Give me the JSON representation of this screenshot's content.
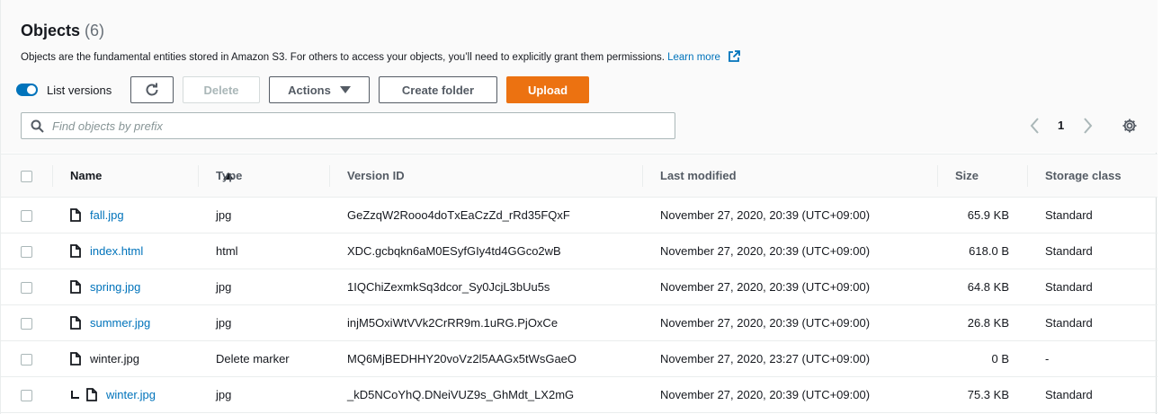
{
  "header": {
    "title": "Objects",
    "count": "(6)",
    "description": "Objects are the fundamental entities stored in Amazon S3. For others to access your objects, you’ll need to explicitly grant them permissions.",
    "learn_more": "Learn more"
  },
  "toolbar": {
    "list_versions_label": "List versions",
    "list_versions_enabled": true,
    "delete_label": "Delete",
    "actions_label": "Actions",
    "create_folder_label": "Create folder",
    "upload_label": "Upload"
  },
  "search": {
    "placeholder": "Find objects by prefix",
    "value": ""
  },
  "pagination": {
    "current_page": "1"
  },
  "table": {
    "columns": {
      "name": "Name",
      "type": "Type",
      "version_id": "Version ID",
      "last_modified": "Last modified",
      "size": "Size",
      "storage_class": "Storage class"
    },
    "rows": [
      {
        "name": "fall.jpg",
        "type": "jpg",
        "version_id": "GeZzqW2Rooo4doTxEaCzZd_rRd35FQxF",
        "last_modified": "November 27, 2020, 20:39 (UTC+09:00)",
        "size": "65.9 KB",
        "storage_class": "Standard"
      },
      {
        "name": "index.html",
        "type": "html",
        "version_id": "XDC.gcbqkn6aM0ESyfGIy4td4GGco2wB",
        "last_modified": "November 27, 2020, 20:39 (UTC+09:00)",
        "size": "618.0 B",
        "storage_class": "Standard"
      },
      {
        "name": "spring.jpg",
        "type": "jpg",
        "version_id": "1IQChiZexmkSq3dcor_Sy0JcjL3bUu5s",
        "last_modified": "November 27, 2020, 20:39 (UTC+09:00)",
        "size": "64.8 KB",
        "storage_class": "Standard"
      },
      {
        "name": "summer.jpg",
        "type": "jpg",
        "version_id": "injM5OxiWtVVk2CrRR9m.1uRG.PjOxCe",
        "last_modified": "November 27, 2020, 20:39 (UTC+09:00)",
        "size": "26.8 KB",
        "storage_class": "Standard"
      },
      {
        "name": "winter.jpg",
        "type": "Delete marker",
        "version_id": "MQ6MjBEDHHY20voVz2l5AAGx5tWsGaeO",
        "last_modified": "November 27, 2020, 23:27 (UTC+09:00)",
        "size": "0 B",
        "storage_class": "-"
      },
      {
        "name": "winter.jpg",
        "type": "jpg",
        "version_id": "_kD5NCoYhQ.DNeiVUZ9s_GhMdt_LX2mG",
        "last_modified": "November 27, 2020, 20:39 (UTC+09:00)",
        "size": "75.3 KB",
        "storage_class": "Standard"
      }
    ]
  },
  "colors": {
    "link": "#0073bb",
    "primary_button": "#ec7211",
    "toggle": "#0073bb"
  },
  "icons": [
    "external-link-icon",
    "refresh-icon",
    "caret-down-icon",
    "search-icon",
    "chevron-left-icon",
    "chevron-right-icon",
    "gear-icon",
    "sort-asc-icon",
    "file-icon",
    "version-branch-icon"
  ]
}
